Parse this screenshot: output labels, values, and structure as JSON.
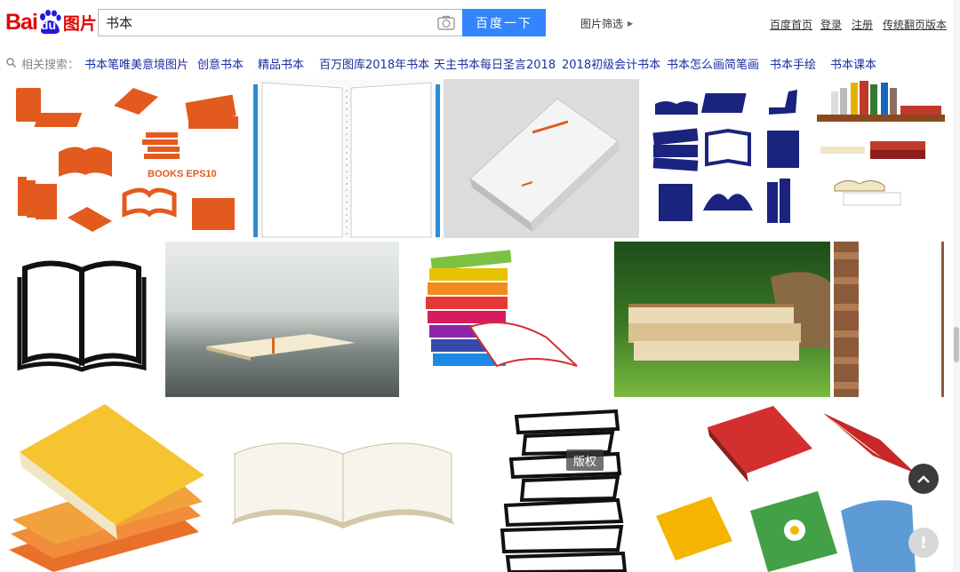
{
  "logo": {
    "text_bai": "Bai",
    "text_du": "du",
    "text_pic": "图片"
  },
  "search": {
    "query": "书本",
    "button_label": "百度一下",
    "camera_icon": "camera-icon"
  },
  "filter": {
    "label": "图片筛选",
    "icon": "triangle-right-icon"
  },
  "top_links": [
    "百度首页",
    "登录",
    "注册",
    "传统翻页版本"
  ],
  "related": {
    "label": "相关搜索：",
    "items": [
      "书本笔唯美意境图片",
      "创意书本",
      "精品书本",
      "百万图库2018年书本",
      "天主书本每日圣言2018",
      "2018初级会计书本",
      "书本怎么画简笔画",
      "书本手绘",
      "书本课本"
    ]
  },
  "grid": {
    "copyright_badge": "版权",
    "watermark_text": "BOOKS EPS10"
  },
  "controls": {
    "scroll_top_icon": "chevron-up-icon",
    "feedback_icon": "exclamation-icon",
    "feedback_text": "!"
  },
  "colors": {
    "brand_red": "#e10601",
    "brand_blue": "#3385ff",
    "link_blue": "#1a2ea0",
    "orange_icon": "#e35a1e",
    "navy_icon": "#1a237e"
  }
}
